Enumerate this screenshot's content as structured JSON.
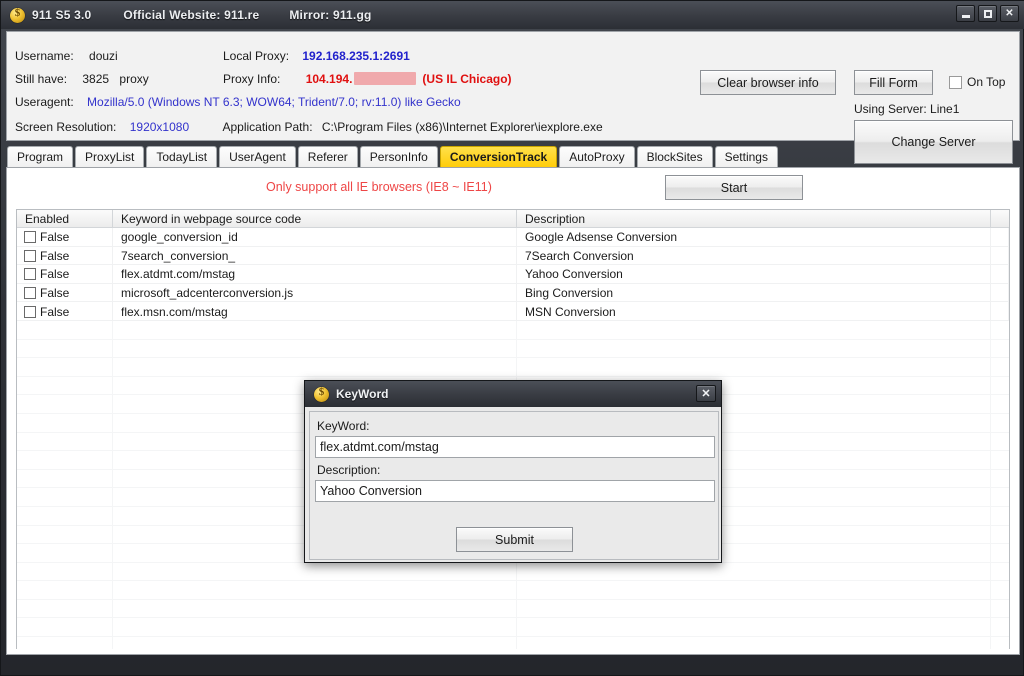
{
  "window": {
    "title": "911 S5 3.0",
    "official_website": "Official Website: 911.re",
    "mirror": "Mirror: 911.gg",
    "icon": "dollar-coin-icon",
    "controls": {
      "minimize": "minimize-icon",
      "maximize": "maximize-icon",
      "close": "✕"
    }
  },
  "info": {
    "username_label": "Username:",
    "username_value": "douzi",
    "still_have_label": "Still have:",
    "still_have_value": "3825",
    "still_have_unit": "proxy",
    "useragent_label": "Useragent:",
    "useragent_value": "Mozilla/5.0 (Windows NT 6.3; WOW64; Trident/7.0; rv:11.0) like Gecko",
    "screen_resolution_label": "Screen Resolution:",
    "screen_resolution_value": "1920x1080",
    "application_path_label": "Application Path:",
    "application_path_value": "C:\\Program Files (x86)\\Internet Explorer\\iexplore.exe",
    "local_proxy_label": "Local Proxy:",
    "local_proxy_value": "192.168.235.1:2691",
    "proxy_info_label": "Proxy Info:",
    "proxy_info_prefix": "104.194.",
    "proxy_info_location": "(US IL Chicago)",
    "redaction_color": "#f0a9ac"
  },
  "toolbar": {
    "clear_browser_info": "Clear browser info",
    "fill_form": "Fill Form",
    "on_top": "On Top",
    "using_server": "Using Server: Line1",
    "change_server": "Change Server"
  },
  "tabs": [
    {
      "label": "Program",
      "active": false
    },
    {
      "label": "ProxyList",
      "active": false
    },
    {
      "label": "TodayList",
      "active": false
    },
    {
      "label": "UserAgent",
      "active": false
    },
    {
      "label": "Referer",
      "active": false
    },
    {
      "label": "PersonInfo",
      "active": false
    },
    {
      "label": "ConversionTrack",
      "active": true
    },
    {
      "label": "AutoProxy",
      "active": false
    },
    {
      "label": "BlockSites",
      "active": false
    },
    {
      "label": "Settings",
      "active": false
    }
  ],
  "main": {
    "support_note": "Only support all IE browsers (IE8 ~ IE11)",
    "start_button": "Start"
  },
  "table": {
    "columns": [
      "Enabled",
      "Keyword in webpage source code",
      "Description",
      ""
    ],
    "rows": [
      {
        "enabled": "False",
        "keyword": "google_conversion_id",
        "description": "Google Adsense Conversion"
      },
      {
        "enabled": "False",
        "keyword": "7search_conversion_",
        "description": "7Search Conversion"
      },
      {
        "enabled": "False",
        "keyword": "flex.atdmt.com/mstag",
        "description": "Yahoo Conversion"
      },
      {
        "enabled": "False",
        "keyword": "microsoft_adcenterconversion.js",
        "description": "Bing Conversion"
      },
      {
        "enabled": "False",
        "keyword": "flex.msn.com/mstag",
        "description": "MSN Conversion"
      }
    ]
  },
  "dialog": {
    "title": "KeyWord",
    "icon": "dollar-coin-icon",
    "close_label": "✕",
    "keyword_label": "KeyWord:",
    "keyword_value": "flex.atdmt.com/mstag",
    "description_label": "Description:",
    "description_value": "Yahoo Conversion",
    "submit_label": "Submit"
  },
  "colors": {
    "accent_tab": "#ffd92e",
    "warning_text": "#ee4646",
    "link_blue": "#2222cc",
    "proxy_red": "#e01010"
  }
}
